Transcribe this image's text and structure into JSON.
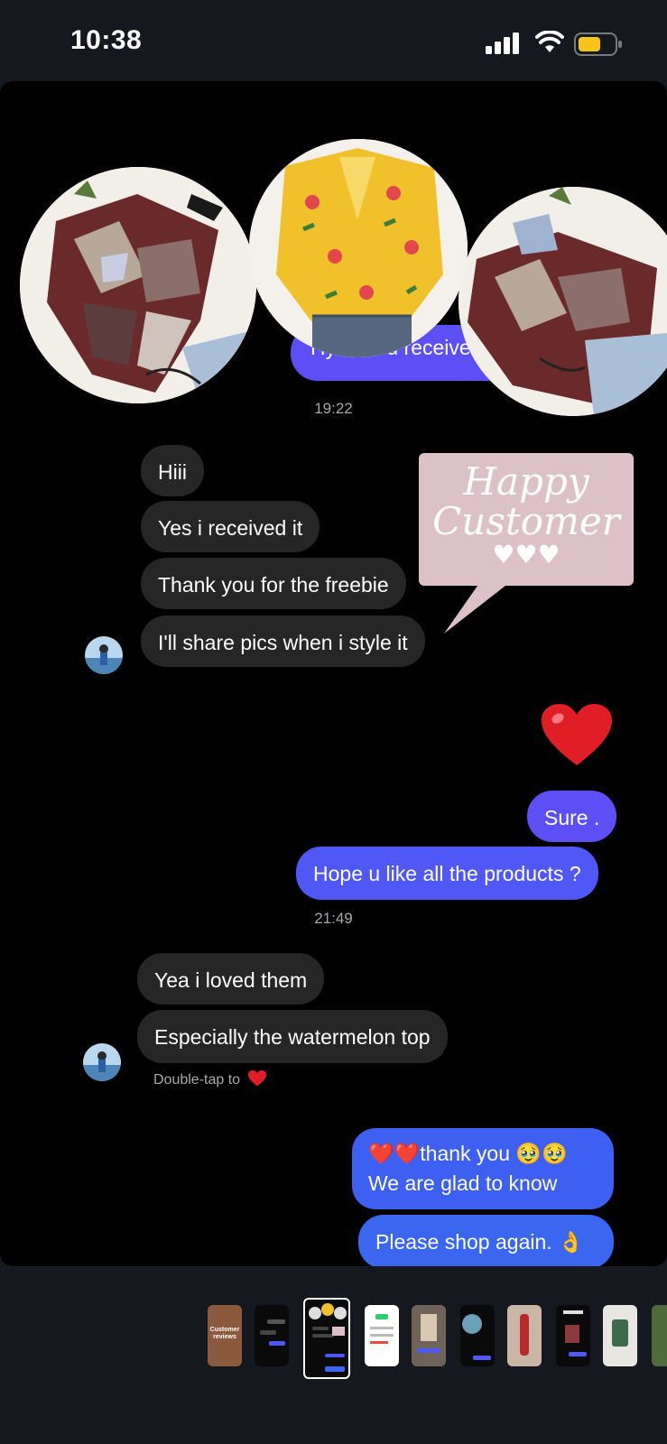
{
  "status_bar": {
    "time": "10:38"
  },
  "photos": {
    "partial_message": "Hy I did u receive"
  },
  "timestamps": [
    "19:22",
    "21:49"
  ],
  "sticker": {
    "line1": "Happy",
    "line2": "Customer",
    "hearts": "♥♥♥"
  },
  "messages_group1": [
    {
      "text": "Hiii"
    },
    {
      "text": "Yes i received it"
    },
    {
      "text": "Thank you for the freebie"
    },
    {
      "text": "I'll share pics when i style it"
    }
  ],
  "reaction_heart": "❤️",
  "outgoing1": [
    {
      "text": "Sure ."
    },
    {
      "text": "Hope u like all the products ?"
    }
  ],
  "messages_group2": [
    {
      "text": "Yea i loved them"
    },
    {
      "text": "Especially the watermelon top"
    }
  ],
  "double_tap_hint": "Double-tap to",
  "outgoing2": {
    "line1": "❤️❤️thank you 🥹🥹",
    "line2": "We are glad to know",
    "last": "Please shop again. 👌"
  },
  "thumbnail_strip": {
    "first_label": "Customer reviews"
  },
  "colors": {
    "background": "#000000",
    "incoming_bubble": "#262626",
    "outgoing_purple": "#5b4ff5",
    "outgoing_blue": "#3a66f0",
    "sticker_pink": "#dcc2c8",
    "battery_yellow": "#f5c518"
  }
}
